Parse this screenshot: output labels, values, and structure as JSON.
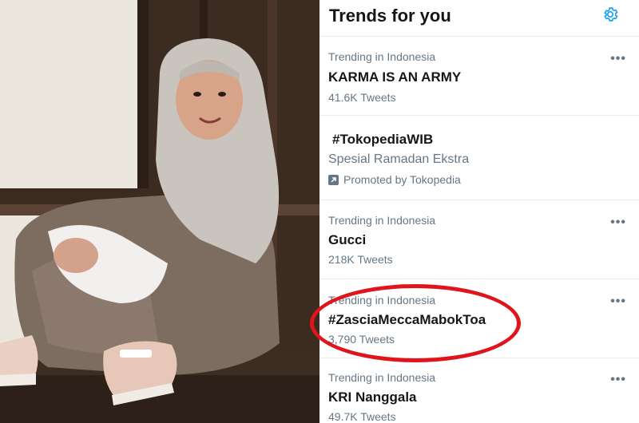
{
  "panel": {
    "title": "Trends for you",
    "settings_icon": "gear-icon",
    "more_icon": "more-horizontal-icon",
    "accent_color": "#1da1f2"
  },
  "trends": [
    {
      "context": "Trending in Indonesia",
      "name": "KARMA IS AN ARMY",
      "count": "41.6K Tweets"
    },
    {
      "promoted": true,
      "name": "#TokopediaWIB",
      "description": "Spesial Ramadan Ekstra",
      "promoted_by": "Promoted by Tokopedia"
    },
    {
      "context": "Trending in Indonesia",
      "name": "Gucci",
      "count": "218K Tweets"
    },
    {
      "context": "Trending in Indonesia",
      "name": "#ZasciaMeccaMabokToa",
      "count": "3,790 Tweets",
      "highlighted": true
    },
    {
      "context": "Trending in Indonesia",
      "name": "KRI Nanggala",
      "count": "49.7K Tweets"
    }
  ],
  "highlight_color": "#e0141b"
}
